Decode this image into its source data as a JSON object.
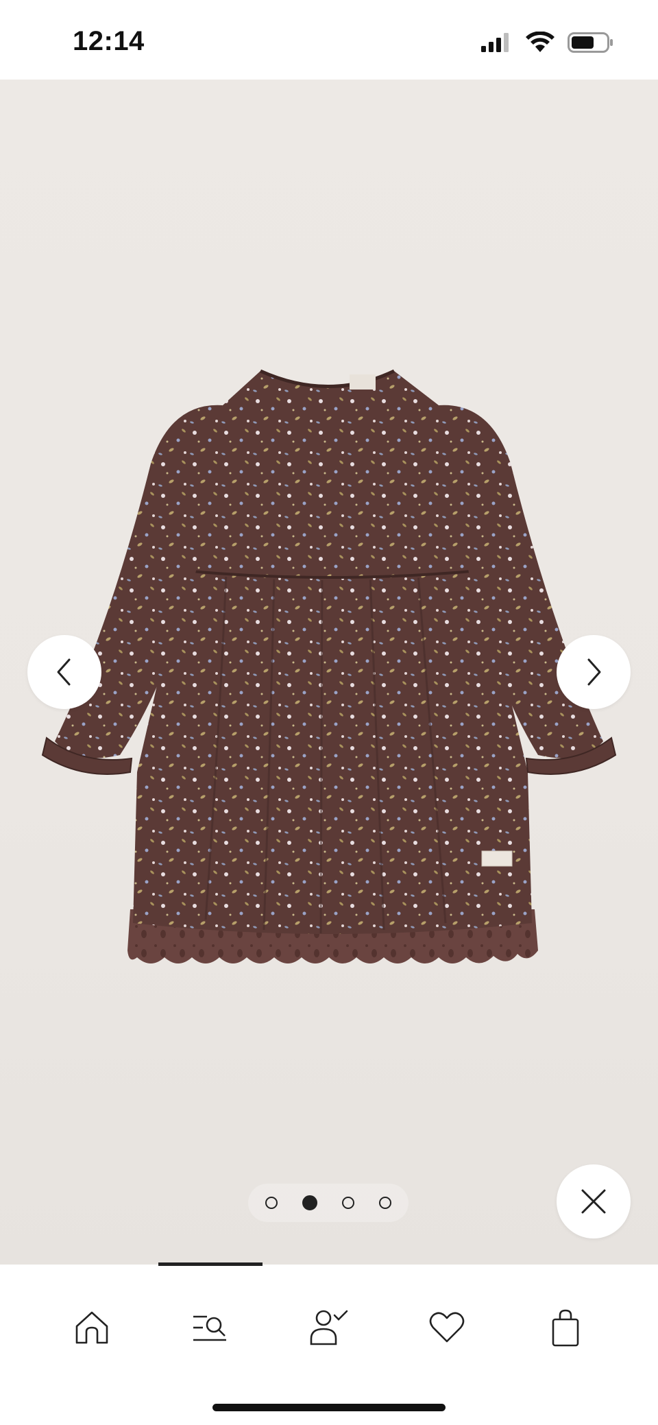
{
  "status_bar": {
    "time": "12:14",
    "icons": [
      "signal-icon",
      "wifi-icon",
      "battery-icon"
    ]
  },
  "gallery": {
    "image_name": "floral-dress-image",
    "total_slides": 4,
    "active_slide": 2,
    "controls": {
      "prev_icon": "chevron-left-icon",
      "next_icon": "chevron-right-icon",
      "close_icon": "close-icon"
    }
  },
  "tabbar": {
    "items": [
      {
        "name": "home",
        "icon": "home-icon"
      },
      {
        "name": "search",
        "icon": "search-menu-icon"
      },
      {
        "name": "account",
        "icon": "account-icon"
      },
      {
        "name": "favorites",
        "icon": "heart-icon"
      },
      {
        "name": "bag",
        "icon": "shopping-bag-icon"
      }
    ]
  },
  "colors": {
    "background": "#ece8e4",
    "dress": "#5b3a36",
    "hem": "#6a4440",
    "ui": "#222222"
  }
}
